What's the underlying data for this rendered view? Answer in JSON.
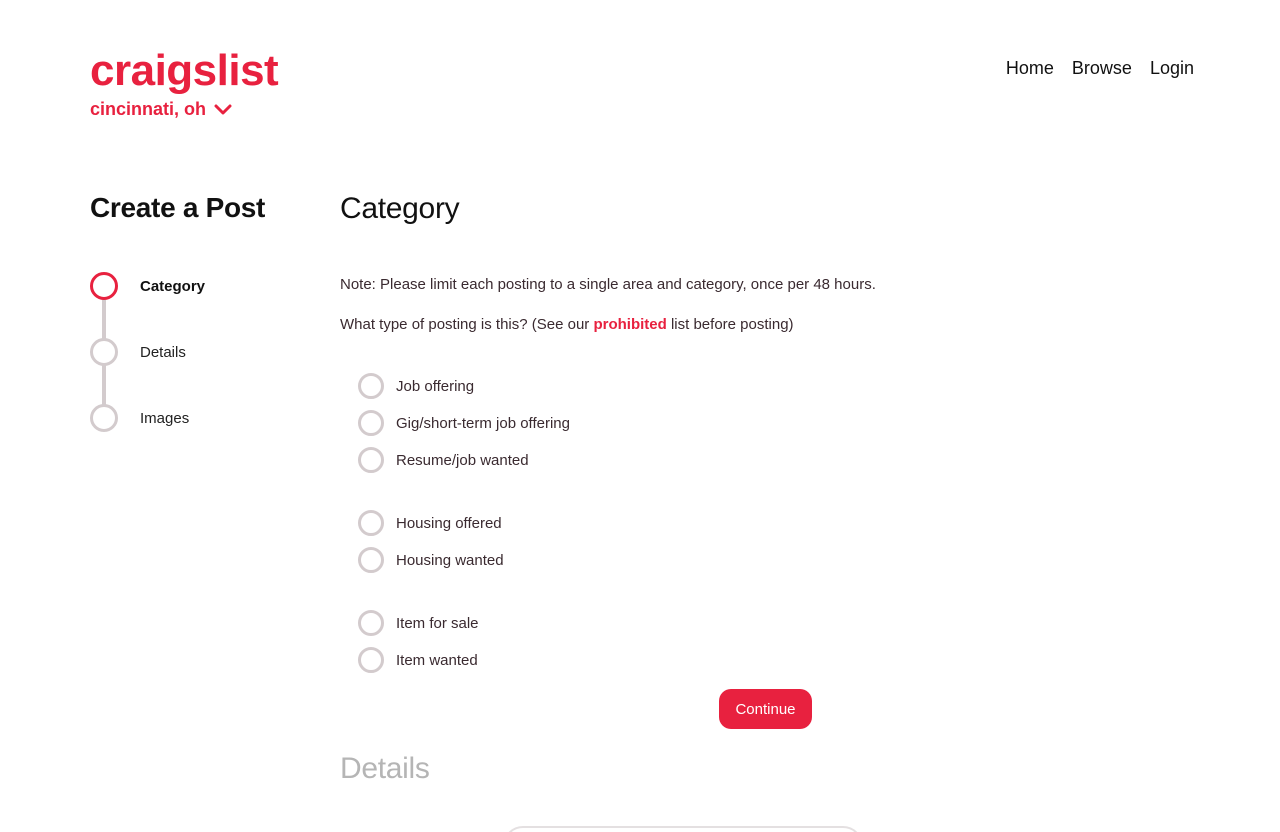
{
  "header": {
    "logo": "craigslist",
    "location": "cincinnati, oh",
    "nav": [
      "Home",
      "Browse",
      "Login"
    ]
  },
  "sidebar": {
    "title": "Create a Post",
    "steps": [
      {
        "label": "Category",
        "active": true
      },
      {
        "label": "Details",
        "active": false
      },
      {
        "label": "Images",
        "active": false
      }
    ]
  },
  "main": {
    "title": "Category",
    "note": "Note: Please limit each posting to a single area and category, once per 48 hours.",
    "question_pre": "What type of posting is this? (See our ",
    "question_link": "prohibited",
    "question_post": " list before posting)",
    "options": [
      "Job offering",
      "Gig/short-term job offering",
      "Resume/job wanted",
      "Housing offered",
      "Housing wanted",
      "Item for sale",
      "Item wanted"
    ],
    "continue_label": "Continue",
    "next_section_title": "Details"
  },
  "colors": {
    "accent": "#e8213f",
    "muted_border": "#d3cbcd",
    "text": "#111111",
    "muted_heading": "#b5b5b5"
  },
  "icons": {
    "location_toggle": "chevron-down-icon"
  }
}
